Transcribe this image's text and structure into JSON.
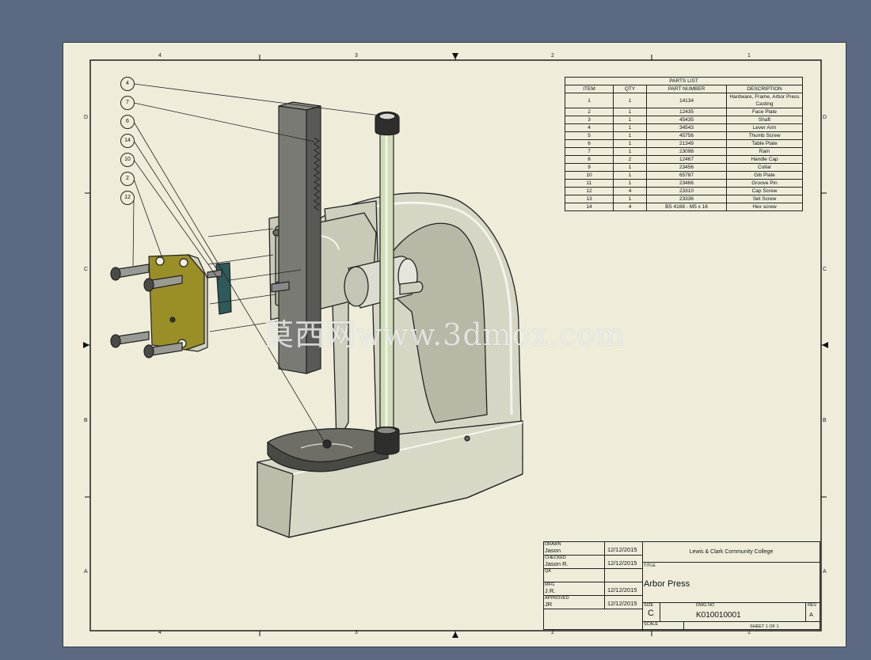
{
  "zones": {
    "top": [
      "4",
      "3",
      "2",
      "1"
    ],
    "bottom": [
      "4",
      "3",
      "2",
      "1"
    ],
    "left": [
      "D",
      "C",
      "B",
      "A"
    ],
    "right": [
      "D",
      "C",
      "B",
      "A"
    ]
  },
  "balloons": [
    "4",
    "7",
    "6",
    "14",
    "10",
    "2",
    "12"
  ],
  "parts_list": {
    "title": "PARTS LIST",
    "headers": [
      "ITEM",
      "QTY",
      "PART NUMBER",
      "DESCRIPTION"
    ],
    "rows": [
      [
        "1",
        "1",
        "14134",
        "Hardware, Frame, Arbor Press Casting"
      ],
      [
        "2",
        "1",
        "12435",
        "Face Plate"
      ],
      [
        "3",
        "1",
        "45435",
        "Shaft"
      ],
      [
        "4",
        "1",
        "34543",
        "Lever Arm"
      ],
      [
        "5",
        "1",
        "45756",
        "Thumb Screw"
      ],
      [
        "6",
        "1",
        "21349",
        "Table Plate"
      ],
      [
        "7",
        "1",
        "23098",
        "Ram"
      ],
      [
        "8",
        "2",
        "12467",
        "Handle Cap"
      ],
      [
        "9",
        "1",
        "23456",
        "Collar"
      ],
      [
        "10",
        "1",
        "65787",
        "Gib Plate"
      ],
      [
        "11",
        "1",
        "23466",
        "Groove Pin"
      ],
      [
        "12",
        "4",
        "23310",
        "Cap Screw"
      ],
      [
        "13",
        "1",
        "23336",
        "Set Screw"
      ],
      [
        "14",
        "4",
        "BS 4168 - M5 x 16",
        "Hex screw"
      ]
    ]
  },
  "title_block": {
    "drawn_label": "DRAWN",
    "drawn_name": "Jason",
    "drawn_date": "12/12/2015",
    "checked_label": "CHECKED",
    "checked_name": "Jason R.",
    "checked_date": "12/12/2015",
    "qa_label": "QA",
    "mfg_label": "MFG",
    "mfg_name": "J.R.",
    "mfg_date": "12/12/2015",
    "approved_label": "APPROVED",
    "approved_name": "JR",
    "approved_date": "12/12/2015",
    "company": "Lewis & Clark Community College",
    "title_label": "TITLE",
    "title": "Arbor Press",
    "size_label": "SIZE",
    "size": "C",
    "dwg_label": "DWG NO",
    "dwg_no": "K010010001",
    "rev_label": "REV",
    "rev": "A",
    "scale_label": "SCALE",
    "sheet": "SHEET 1  OF 1"
  },
  "watermark": "莫西网www.3dmox.com"
}
